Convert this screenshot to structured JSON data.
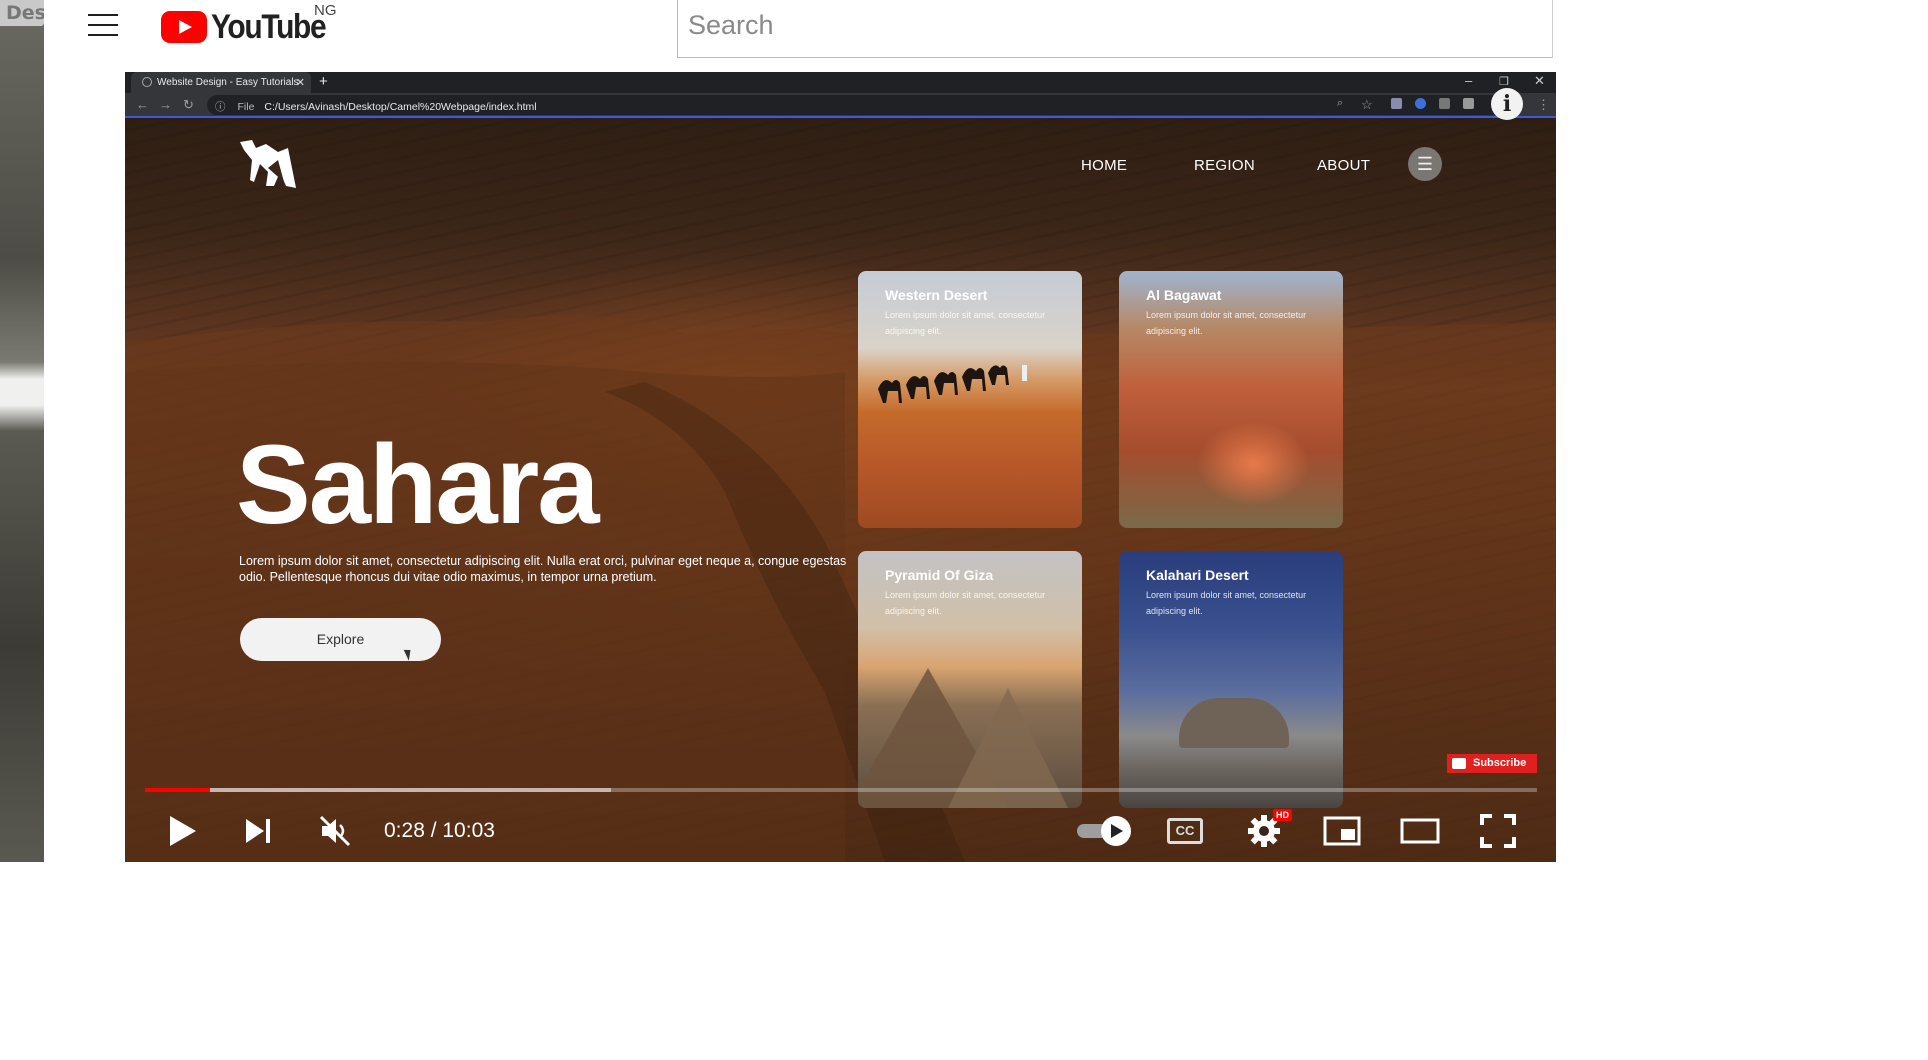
{
  "left_window": {
    "label": "Des"
  },
  "youtube": {
    "logo_text": "YouTube",
    "country": "NG",
    "search_placeholder": "Search"
  },
  "browser": {
    "tab_title": "Website Design - Easy Tutorials",
    "address_prefix": "File",
    "url": "C:/Users/Avinash/Desktop/Camel%20Webpage/index.html"
  },
  "site": {
    "nav": [
      "HOME",
      "REGION",
      "ABOUT"
    ],
    "hero_title": "Sahara",
    "hero_desc": "Lorem ipsum dolor sit amet, consectetur adipiscing elit. Nulla erat orci, pulvinar eget neque a, congue egestas odio. Pellentesque rhoncus dui vitae odio maximus, in tempor urna pretium.",
    "explore_label": "Explore",
    "cards": [
      {
        "title": "Western Desert",
        "text": "Lorem ipsum dolor sit amet, consectetur adipiscing elit."
      },
      {
        "title": "Al Bagawat",
        "text": "Lorem ipsum dolor sit amet, consectetur adipiscing elit."
      },
      {
        "title": "Pyramid Of Giza",
        "text": "Lorem ipsum dolor sit amet, consectetur adipiscing elit."
      },
      {
        "title": "Kalahari Desert",
        "text": "Lorem ipsum dolor sit amet, consectetur adipiscing elit."
      }
    ]
  },
  "player": {
    "subscribe_label": "Subscribe",
    "current_time": "0:28",
    "duration": "10:03",
    "time_display": "0:28 / 10:03",
    "played_fraction": 0.047,
    "buffered_fraction": 0.335,
    "hd_badge": "HD",
    "cc_label": "CC",
    "accent_color": "#ff0000"
  }
}
